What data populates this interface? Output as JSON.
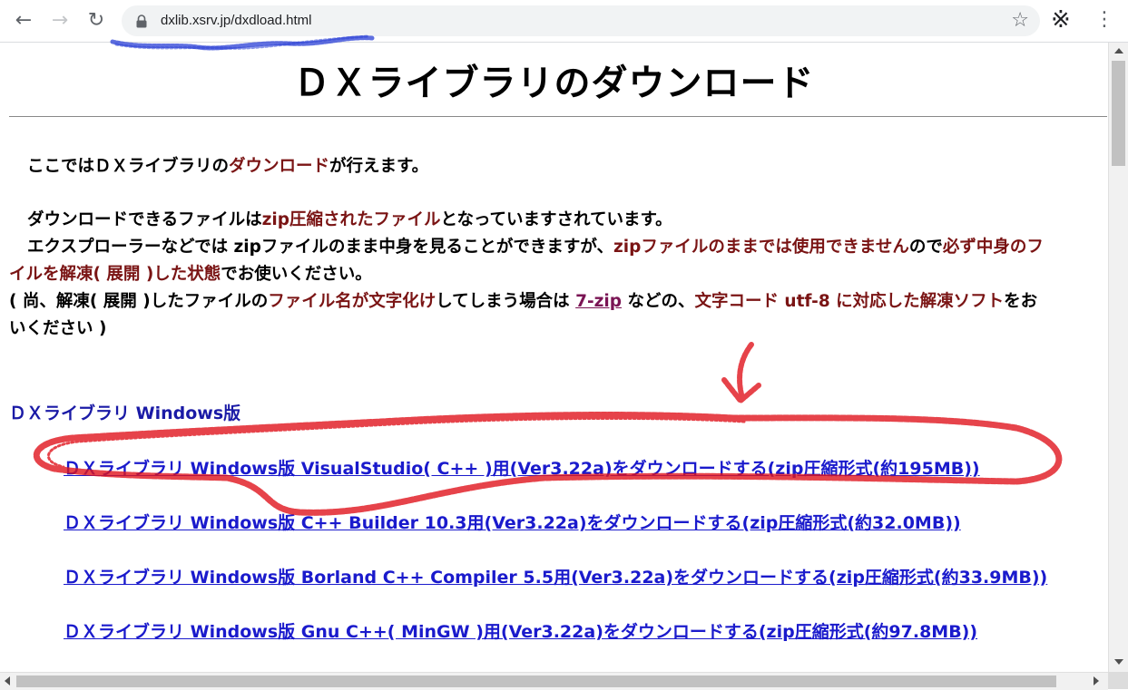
{
  "browser": {
    "url": "dxlib.xsrv.jp/dxdload.html",
    "back_icon": "←",
    "forward_icon": "→",
    "reload_icon": "↻",
    "star_icon": "☆",
    "extension_icon": "※",
    "menu_icon": "⋮"
  },
  "page": {
    "title": "ＤＸライブラリのダウンロード",
    "intro": {
      "p1_a": "ここではＤＸライブラリの",
      "p1_b": "ダウンロード",
      "p1_c": "が行えます。"
    },
    "notes": {
      "l1_a": "ダウンロードできるファイルは",
      "l1_b": "zip圧縮されたファイル",
      "l1_c": "となっていますされています。",
      "l2_a": "エクスプローラーなどでは zipファイルのまま中身を見ることができますが、",
      "l2_b": "zipファイルのままでは使用できません",
      "l2_c": "ので",
      "l2_d": "必ず中身のフ",
      "l3_a": "イルを解凍( 展開 )した状態",
      "l3_b": "でお使いください。",
      "l4_a": "( 尚、解凍( 展開 )したファイルの",
      "l4_b": "ファイル名が文字化け",
      "l4_c": "してしまう場合は ",
      "l4_link": "7-zip",
      "l4_d": " などの、",
      "l4_e": "文字コード utf-8 に対応した解凍ソフト",
      "l4_f": "をお",
      "l5": "いください )"
    },
    "section_heading": "ＤＸライブラリ Windows版",
    "downloads": [
      "ＤＸライブラリ Windows版 VisualStudio( C++ )用(Ver3.22a)をダウンロードする(zip圧縮形式(約195MB))",
      "ＤＸライブラリ Windows版 C++ Builder 10.3用(Ver3.22a)をダウンロードする(zip圧縮形式(約32.0MB))",
      "ＤＸライブラリ Windows版 Borland C++ Compiler 5.5用(Ver3.22a)をダウンロードする(zip圧縮形式(約33.9MB))",
      "ＤＸライブラリ Windows版 Gnu C++( MinGW )用(Ver3.22a)をダウンロードする(zip圧縮形式(約97.8MB))"
    ]
  },
  "colors": {
    "highlight_text": "#7a1414",
    "link": "#1a1acc",
    "heading_link": "#1a1aa6",
    "annotation_red": "#e0151e",
    "annotation_blue": "#2a3fd6"
  }
}
